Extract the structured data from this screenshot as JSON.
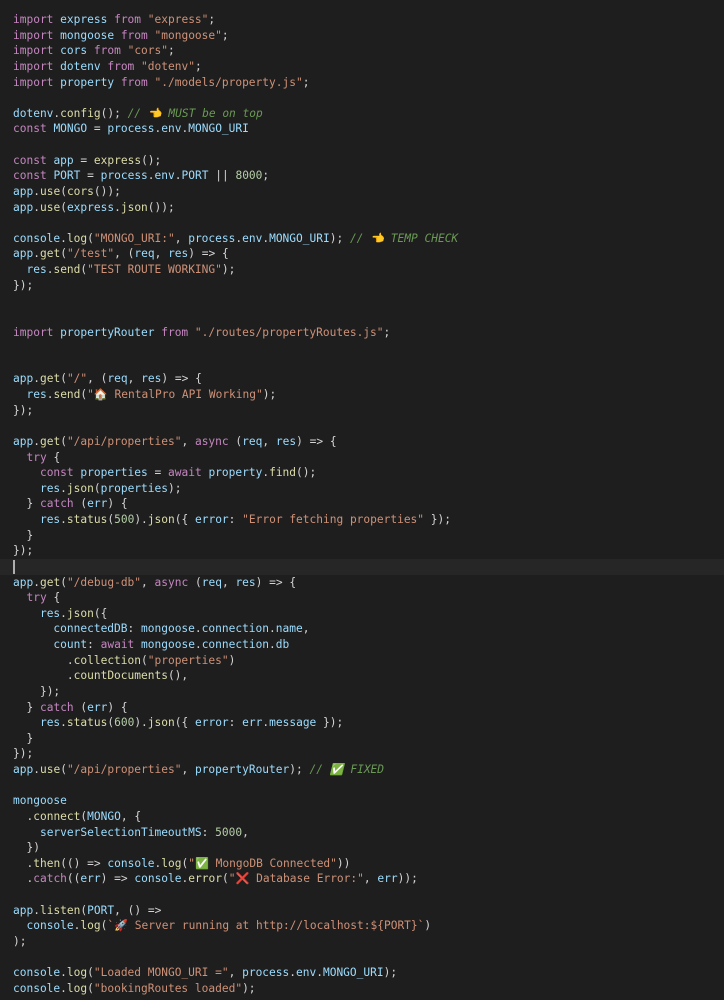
{
  "editor": {
    "lines": [
      "import express from \"express\";",
      "import mongoose from \"mongoose\";",
      "import cors from \"cors\";",
      "import dotenv from \"dotenv\";",
      "import property from \"./models/property.js\";",
      "",
      "dotenv.config(); // 👈 MUST be on top",
      "const MONGO = process.env.MONGO_URI",
      "",
      "const app = express();",
      "const PORT = process.env.PORT || 8000;",
      "app.use(cors());",
      "app.use(express.json());",
      "",
      "console.log(\"MONGO_URI:\", process.env.MONGO_URI); // 👈 TEMP CHECK",
      "app.get(\"/test\", (req, res) => {",
      "  res.send(\"TEST ROUTE WORKING\");",
      "});",
      "",
      "",
      "import propertyRouter from \"./routes/propertyRoutes.js\";",
      "",
      "",
      "app.get(\"/\", (req, res) => {",
      "  res.send(\"🏠 RentalPro API Working\");",
      "});",
      "",
      "app.get(\"/api/properties\", async (req, res) => {",
      "  try {",
      "    const properties = await property.find();",
      "    res.json(properties);",
      "  } catch (err) {",
      "    res.status(500).json({ error: \"Error fetching properties\" });",
      "  }",
      "});",
      "",
      "app.get(\"/debug-db\", async (req, res) => {",
      "  try {",
      "    res.json({",
      "      connectedDB: mongoose.connection.name,",
      "      count: await mongoose.connection.db",
      "        .collection(\"properties\")",
      "        .countDocuments(),",
      "    });",
      "  } catch (err) {",
      "    res.status(600).json({ error: err.message });",
      "  }",
      "});",
      "app.use(\"/api/properties\", propertyRouter); // ✅ FIXED",
      "",
      "mongoose",
      "  .connect(MONGO, {",
      "    serverSelectionTimeoutMS: 5000,",
      "  })",
      "  .then(() => console.log(\"✅ MongoDB Connected\"))",
      "  .catch((err) => console.error(\"❌ Database Error:\", err));",
      "",
      "app.listen(PORT, () =>",
      "  console.log(`🚀 Server running at http://localhost:${PORT}`)",
      ");",
      "",
      "console.log(\"Loaded MONGO_URI =\", process.env.MONGO_URI);",
      "console.log(\"bookingRoutes loaded\");"
    ],
    "current_line_index": 35
  },
  "colors": {
    "background": "#1e1e1e",
    "keyword": "#c586c0",
    "string": "#ce9178",
    "function": "#dcdcaa",
    "variable": "#9cdcfe",
    "number": "#b5cea8",
    "comment": "#6a9955"
  }
}
